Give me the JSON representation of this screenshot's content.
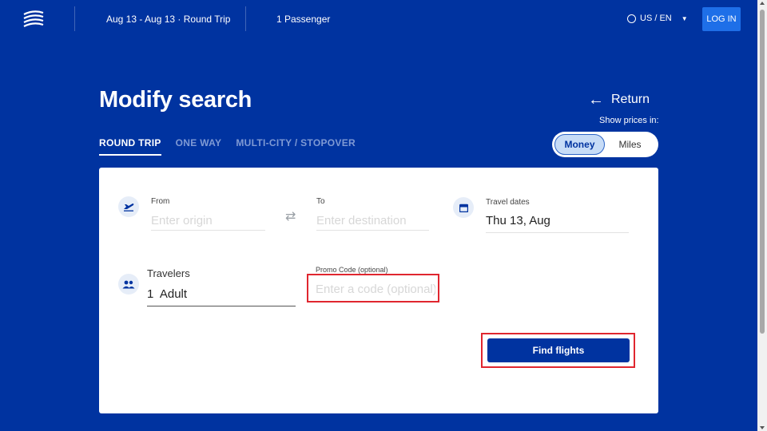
{
  "header": {
    "trip_summary": "Aug 13 - Aug 13 · Round Trip",
    "passenger_summary": "1 Passenger",
    "locale": "US / EN",
    "login_label": "LOG IN"
  },
  "page": {
    "title": "Modify search",
    "return_label": "Return",
    "prices_label": "Show prices in:",
    "currency_options": [
      "Money",
      "Miles"
    ],
    "currency_selected": "Money"
  },
  "tabs": [
    {
      "label": "ROUND TRIP",
      "active": true
    },
    {
      "label": "ONE WAY",
      "active": false
    },
    {
      "label": "MULTI-CITY / STOPOVER",
      "active": false
    }
  ],
  "form": {
    "from_label": "From",
    "from_placeholder": "Enter origin",
    "to_label": "To",
    "to_placeholder": "Enter destination",
    "dates_label": "Travel dates",
    "dates_value": "Thu 13, Aug",
    "travelers_label": "Travelers",
    "travelers_value": "1  Adult",
    "promo_label": "Promo Code (optional)",
    "promo_placeholder": "Enter a code (optional)",
    "submit_label": "Find flights"
  },
  "colors": {
    "brand_blue": "#0033a0",
    "login_blue": "#1e6fe8",
    "highlight_red": "#e0262f"
  }
}
